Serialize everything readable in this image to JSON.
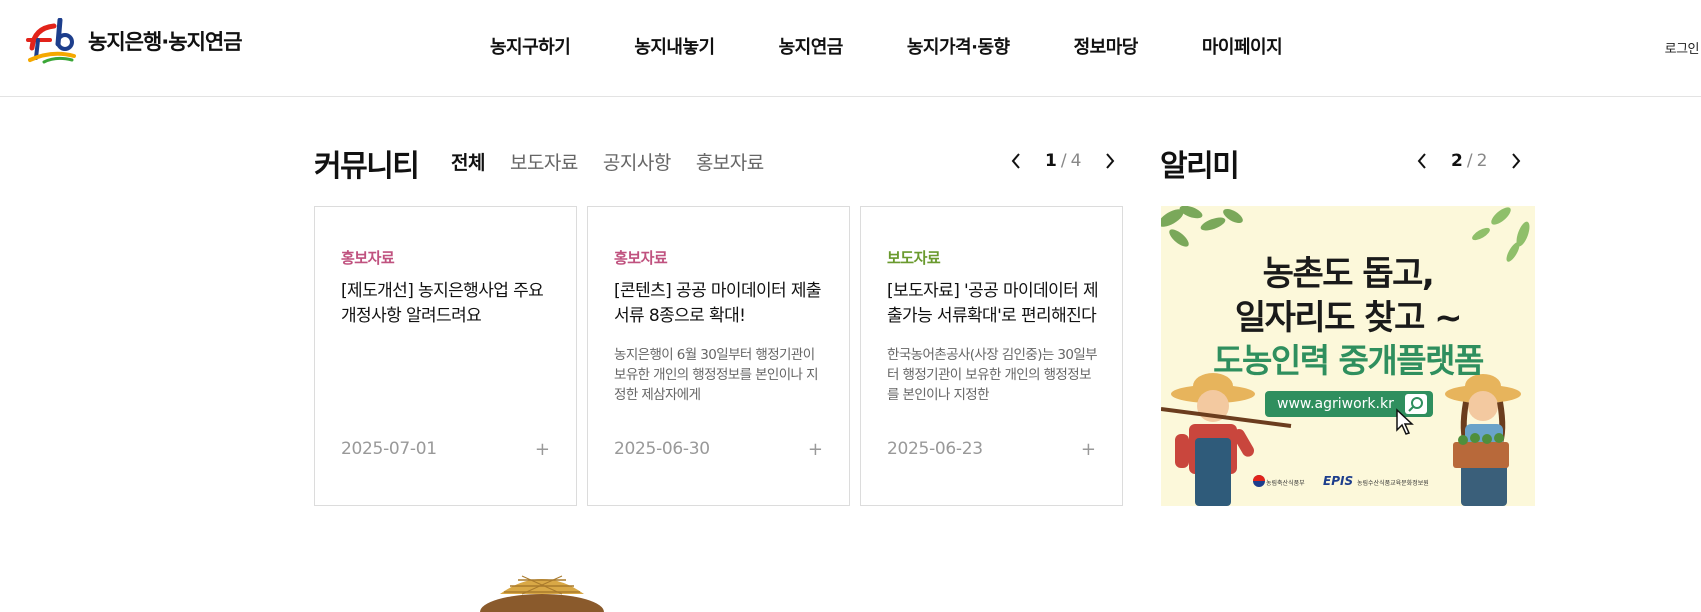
{
  "header": {
    "logo_text": "농지은행·농지연금",
    "logo_mark": "Fb",
    "nav": [
      "농지구하기",
      "농지내놓기",
      "농지연금",
      "농지가격·동향",
      "정보마당",
      "마이페이지"
    ],
    "login_label": "로그인"
  },
  "community": {
    "title": "커뮤니티",
    "tabs": [
      "전체",
      "보도자료",
      "공지사항",
      "홍보자료"
    ],
    "active_tab": "전체",
    "page_current": "1",
    "page_sep": "/",
    "page_total": "4",
    "cards": [
      {
        "category": "홍보자료",
        "title": "[제도개선] 농지은행사업 주요 개정사항 알려드려요",
        "description": "",
        "date": "2025-07-01",
        "more": "+"
      },
      {
        "category": "홍보자료",
        "title": "[콘텐츠] 공공 마이데이터 제출 서류 8종으로 확대!",
        "description": "농지은행이 6월 30일부터 행정기관이 보유한 개인의 행정정보를 본인이나 지정한 제삼자에게",
        "date": "2025-06-30",
        "more": "+"
      },
      {
        "category": "보도자료",
        "title": "[보도자료] '공공 마이데이터 제출가능 서류확대'로 편리해진다",
        "description": "한국농어촌공사(사장 김인중)는 30일부터 행정기관이 보유한 개인의 행정정보를 본인이나 지정한",
        "date": "2025-06-23",
        "more": "+"
      }
    ]
  },
  "alimi": {
    "title": "알리미",
    "page_current": "2",
    "page_sep": "/",
    "page_total": "2",
    "banner": {
      "line1": "농촌도 돕고,",
      "line2": "일자리도 찾고 ~",
      "line3": "도농인력 중개플랫폼",
      "url": "www.agriwork.kr",
      "org_epis": "EPIS",
      "org1": "농림축산식품부",
      "org2": "농림수산식품교육문화정보원"
    }
  },
  "colors": {
    "accent_tab": "#7fe0c7",
    "category_pr": "#c0527f",
    "category_press": "#6a9a2e",
    "banner_green": "#2f8f5e",
    "banner_bg": "#fcf8da"
  },
  "icons": [
    "prev-arrow-icon",
    "next-arrow-icon",
    "plus-icon",
    "search-icon",
    "cursor-icon"
  ]
}
